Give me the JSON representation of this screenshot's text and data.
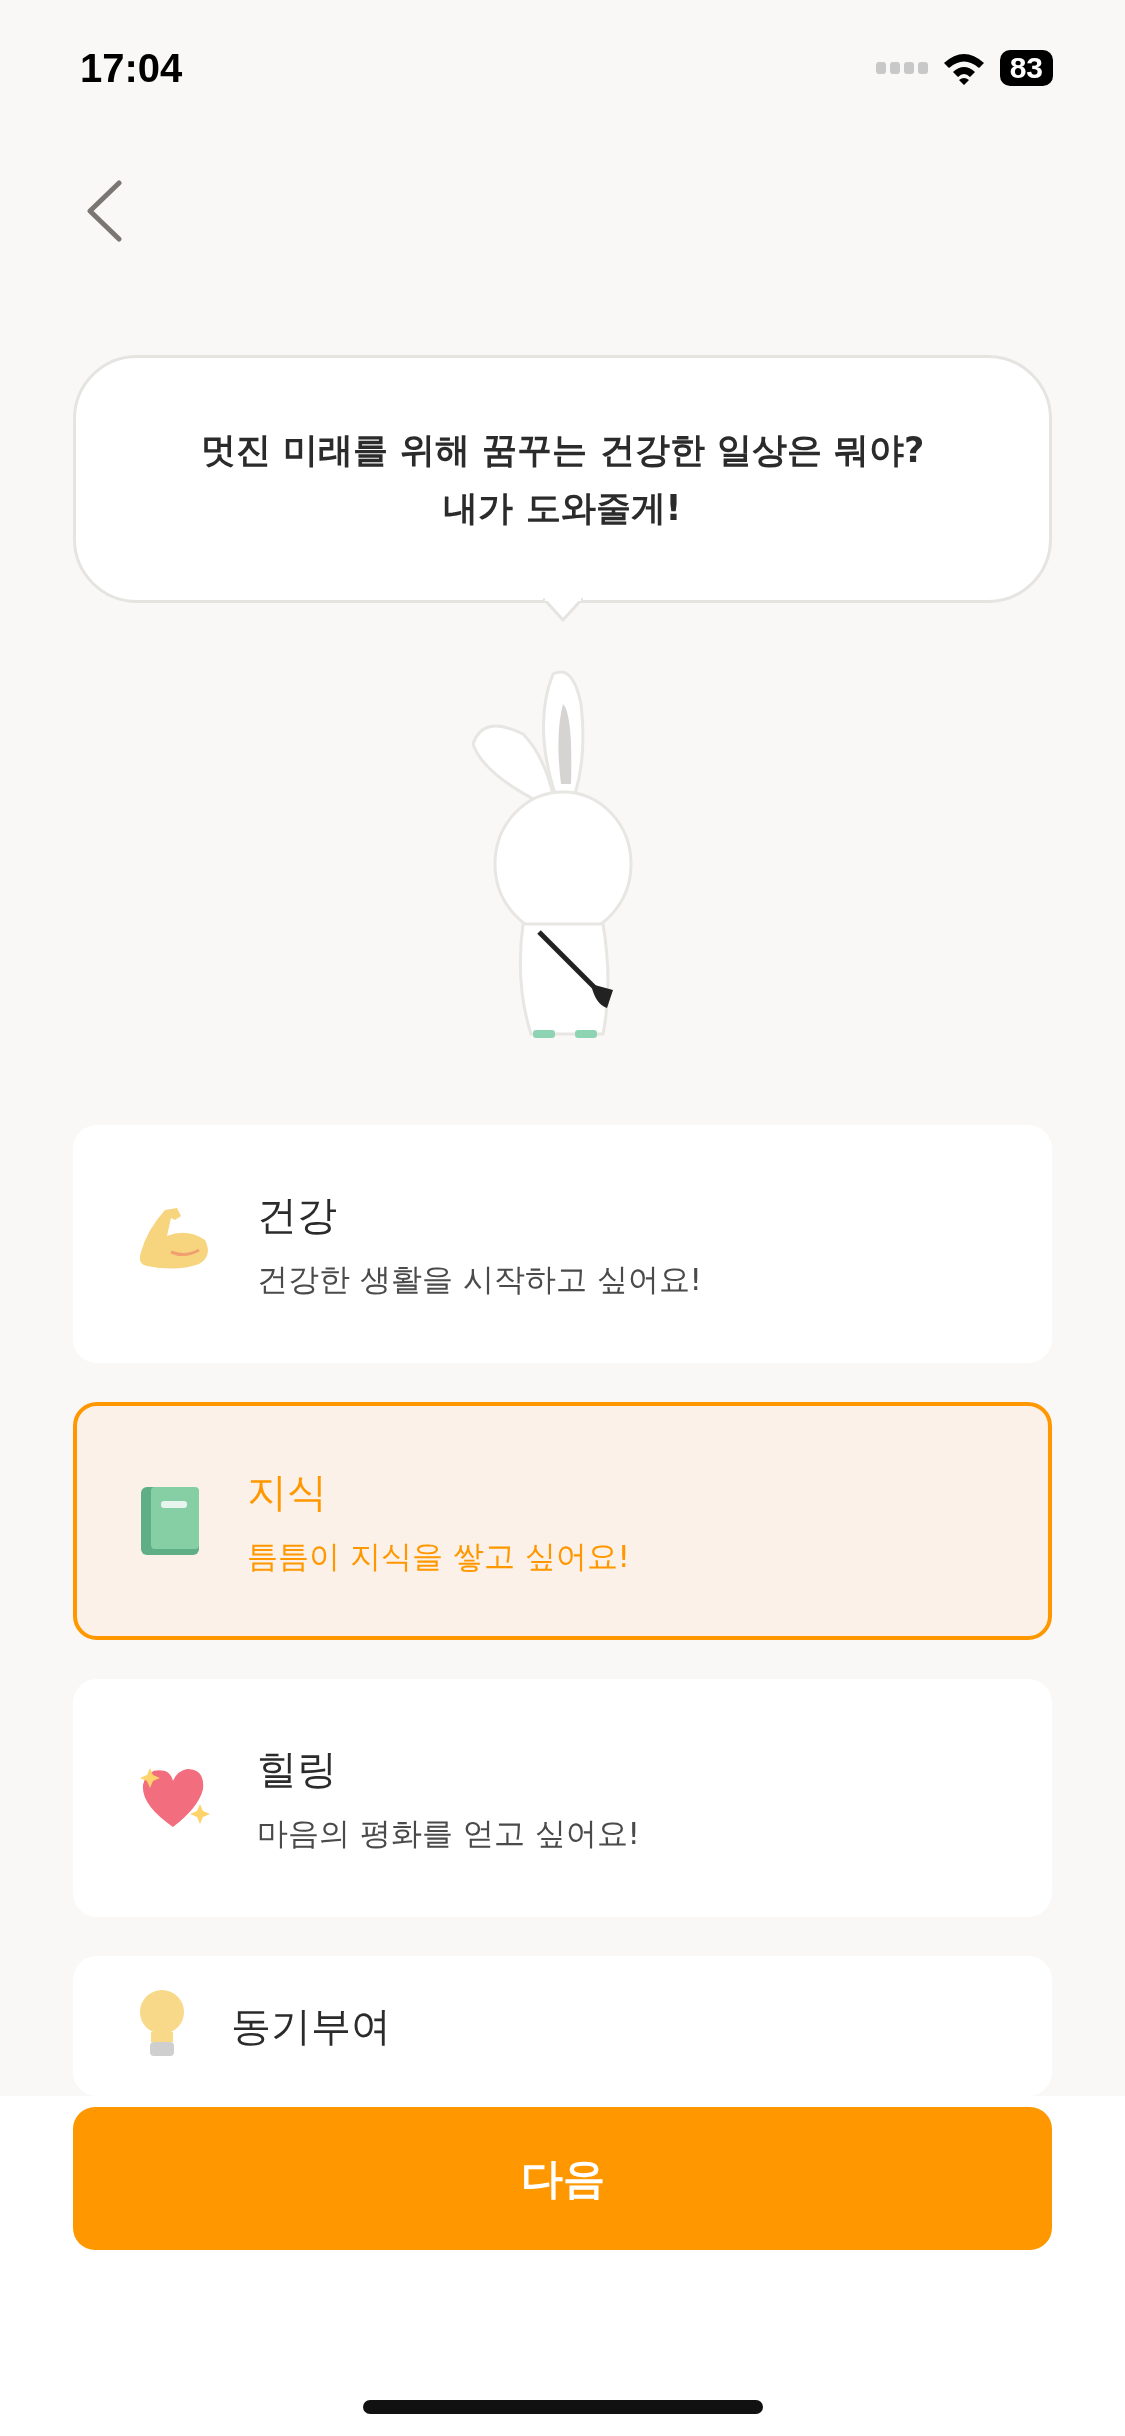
{
  "status_bar": {
    "time": "17:04",
    "battery": "83"
  },
  "speech_bubble": {
    "text": "멋진 미래를 위해 꿈꾸는 건강한 일상은 뭐야?\n내가 도와줄게!"
  },
  "options": [
    {
      "kind": "muscle",
      "title": "건강",
      "subtitle": "건강한 생활을 시작하고 싶어요!",
      "selected": false
    },
    {
      "kind": "book",
      "title": "지식",
      "subtitle": "틈틈이 지식을 쌓고 싶어요!",
      "selected": true
    },
    {
      "kind": "heart",
      "title": "힐링",
      "subtitle": "마음의 평화를 얻고 싶어요!",
      "selected": false
    },
    {
      "kind": "bulb",
      "title": "동기부여",
      "selected": false
    }
  ],
  "next_button": {
    "label": "다음"
  }
}
